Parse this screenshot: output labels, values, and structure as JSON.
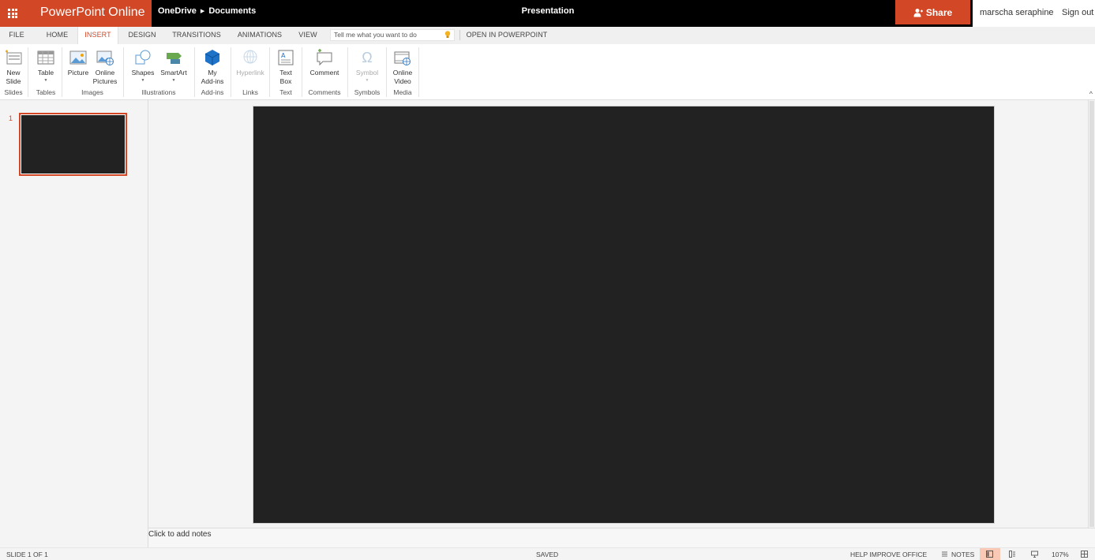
{
  "app": {
    "name": "PowerPoint Online",
    "brand_color": "#d24726"
  },
  "breadcrumb": {
    "root": "OneDrive",
    "folder": "Documents"
  },
  "document": {
    "title": "Presentation"
  },
  "header": {
    "share_label": "Share",
    "user_name": "marscha seraphine",
    "signout_label": "Sign out"
  },
  "tabs": [
    "FILE",
    "HOME",
    "INSERT",
    "DESIGN",
    "TRANSITIONS",
    "ANIMATIONS",
    "VIEW"
  ],
  "active_tab": "INSERT",
  "tell_me": {
    "placeholder": "Tell me what you want to do"
  },
  "open_in_app_label": "OPEN IN POWERPOINT",
  "ribbon": {
    "groups": [
      {
        "label": "Slides"
      },
      {
        "label": "Tables"
      },
      {
        "label": "Images"
      },
      {
        "label": "Illustrations"
      },
      {
        "label": "Add-ins"
      },
      {
        "label": "Links"
      },
      {
        "label": "Text"
      },
      {
        "label": "Comments"
      },
      {
        "label": "Symbols"
      },
      {
        "label": "Media"
      }
    ],
    "buttons": {
      "new_slide": [
        "New",
        "Slide"
      ],
      "table": [
        "Table"
      ],
      "picture": [
        "Picture"
      ],
      "online_pictures": [
        "Online",
        "Pictures"
      ],
      "shapes": [
        "Shapes"
      ],
      "smartart": [
        "SmartArt"
      ],
      "my_addins": [
        "My",
        "Add-ins"
      ],
      "hyperlink": [
        "Hyperlink"
      ],
      "text_box": [
        "Text",
        "Box"
      ],
      "comment": [
        "Comment"
      ],
      "symbol": [
        "Symbol"
      ],
      "online_video": [
        "Online",
        "Video"
      ]
    }
  },
  "slides": {
    "thumb_number": "1"
  },
  "notes": {
    "placeholder": "Click to add notes"
  },
  "status": {
    "slide_position": "SLIDE 1 OF 1",
    "save_state": "SAVED",
    "help_improve": "HELP IMPROVE OFFICE",
    "notes_label": "NOTES",
    "zoom": "107%"
  }
}
